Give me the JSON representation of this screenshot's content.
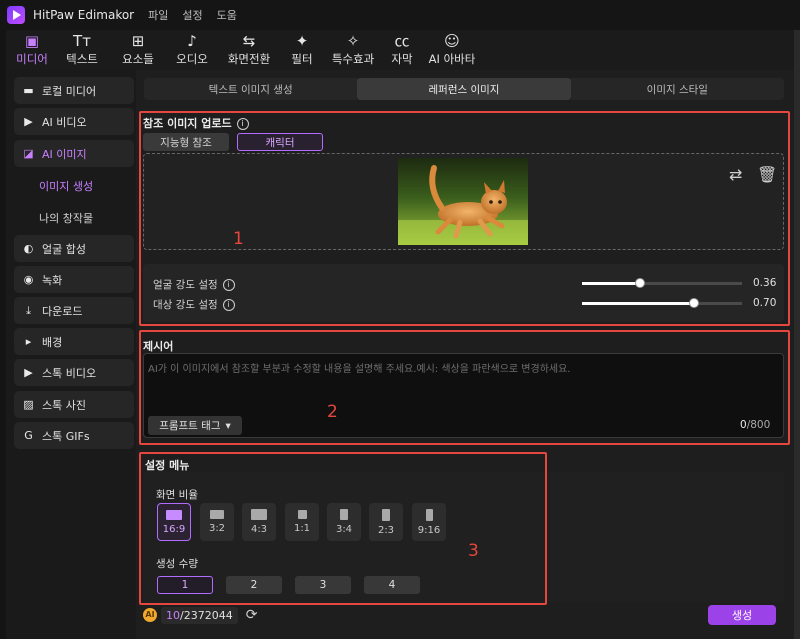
{
  "app": {
    "title": "HitPaw Edimakor",
    "menu": [
      "파일",
      "설정",
      "도움"
    ]
  },
  "toolbar": [
    {
      "label": "미디어",
      "icon": "media-icon",
      "glyph": "▣",
      "active": true
    },
    {
      "label": "텍스트",
      "icon": "text-icon",
      "glyph": "Tт",
      "active": false
    },
    {
      "label": "요소들",
      "icon": "elements-icon",
      "glyph": "⊞",
      "active": false
    },
    {
      "label": "오디오",
      "icon": "audio-icon",
      "glyph": "♪",
      "active": false
    },
    {
      "label": "화면전환",
      "icon": "transition-icon",
      "glyph": "⇆",
      "active": false
    },
    {
      "label": "필터",
      "icon": "filter-icon",
      "glyph": "✦",
      "active": false
    },
    {
      "label": "특수효과",
      "icon": "effects-icon",
      "glyph": "✧",
      "active": false
    },
    {
      "label": "자막",
      "icon": "caption-icon",
      "glyph": "㏄",
      "active": false
    },
    {
      "label": "AI 아바타",
      "icon": "avatar-icon",
      "glyph": "☺",
      "active": false
    }
  ],
  "sidebar": {
    "items": [
      {
        "label": "로컬 미디어",
        "icon": "folder-icon",
        "glyph": "▬"
      },
      {
        "label": "AI 비디오",
        "icon": "ai-video-icon",
        "glyph": "▶"
      },
      {
        "label": "AI 이미지",
        "icon": "ai-image-icon",
        "glyph": "◪"
      },
      {
        "label": "얼굴 합성",
        "icon": "face-swap-icon",
        "glyph": "◐"
      },
      {
        "label": "녹화",
        "icon": "record-icon",
        "glyph": "◉"
      },
      {
        "label": "다운로드",
        "icon": "download-icon",
        "glyph": "⤓"
      },
      {
        "label": "배경",
        "icon": "background-icon",
        "glyph": "▸"
      },
      {
        "label": "스톡 비디오",
        "icon": "stock-video-icon",
        "glyph": "▶"
      },
      {
        "label": "스톡 사진",
        "icon": "stock-photo-icon",
        "glyph": "▨"
      },
      {
        "label": "스톡 GIFs",
        "icon": "gif-icon",
        "glyph": "G"
      }
    ],
    "sub_items": [
      "이미지 생성",
      "나의 창작물"
    ]
  },
  "tabs": [
    "텍스트 이미지 생성",
    "레퍼런스 이미지",
    "이미지 스타일"
  ],
  "reference": {
    "title": "참조 이미지 업로드",
    "modes": [
      "지능형 참조",
      "캐릭터"
    ],
    "annotation": "1"
  },
  "sliders": [
    {
      "label": "얼굴 강도 설정",
      "value": 0.36,
      "value_text": "0.36"
    },
    {
      "label": "대상 강도 설정",
      "value": 0.7,
      "value_text": "0.70"
    }
  ],
  "prompt": {
    "title": "제시어",
    "placeholder": "AI가 이 이미지에서 참조할 부분과 수정할 내용을 설명해 주세요.예시: 색상을 파란색으로 변경하세요.",
    "tag_button": "프롬프트 태그",
    "count": "0",
    "max": "/800",
    "annotation": "2"
  },
  "settings": {
    "title": "설정 메뉴",
    "ratio_label": "화면 비율",
    "ratios": [
      "16:9",
      "3:2",
      "4:3",
      "1:1",
      "3:4",
      "2:3",
      "9:16"
    ],
    "count_label": "생성 수량",
    "counts": [
      "1",
      "2",
      "3",
      "4"
    ],
    "annotation": "3"
  },
  "footer": {
    "coin": "AI",
    "credits_used": "10",
    "credits_total": "/2372044",
    "generate_label": "생성"
  },
  "colors": {
    "accent": "#b06cff",
    "annotation": "#e5463d",
    "generate": "#9b43e8"
  }
}
